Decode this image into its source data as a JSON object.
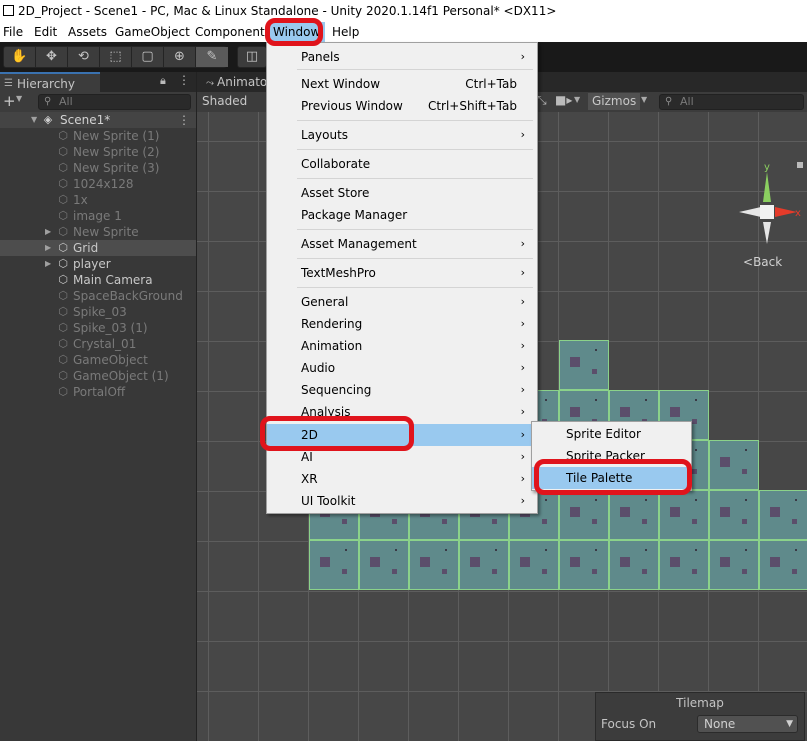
{
  "window": {
    "title": "2D_Project - Scene1 - PC, Mac & Linux Standalone - Unity 2020.1.14f1 Personal* <DX11>"
  },
  "menubar": {
    "items": [
      "File",
      "Edit",
      "Assets",
      "GameObject",
      "Component",
      "Window",
      "Help"
    ]
  },
  "hierarchy": {
    "tab_label": "Hierarchy",
    "add_symbol": "+",
    "search_placeholder": "All",
    "scene_name": "Scene1*",
    "items": [
      {
        "label": "New Sprite (1)",
        "dim": true
      },
      {
        "label": "New Sprite (2)",
        "dim": true
      },
      {
        "label": "New Sprite (3)",
        "dim": true
      },
      {
        "label": "1024x128",
        "dim": true
      },
      {
        "label": "1x",
        "dim": true
      },
      {
        "label": "image 1",
        "dim": true
      },
      {
        "label": "New Sprite",
        "dim": true,
        "expandable": true
      },
      {
        "label": "Grid",
        "dim": false,
        "expandable": true,
        "selected": true
      },
      {
        "label": "player",
        "dim": false,
        "expandable": true
      },
      {
        "label": "Main Camera",
        "dim": false
      },
      {
        "label": "SpaceBackGround",
        "dim": true
      },
      {
        "label": "Spike_03",
        "dim": true
      },
      {
        "label": "Spike_03 (1)",
        "dim": true
      },
      {
        "label": "Crystal_01",
        "dim": true
      },
      {
        "label": "GameObject",
        "dim": true
      },
      {
        "label": "GameObject (1)",
        "dim": true
      },
      {
        "label": "PortalOff",
        "dim": true
      }
    ]
  },
  "scene": {
    "tab_label": "Animato",
    "shading_mode": "Shaded",
    "gizmos_label": "Gizmos",
    "search_placeholder": "All",
    "gizmo_axes": {
      "x": "x",
      "y": "y"
    },
    "back_label": "Back",
    "tilemap_overlay": {
      "title": "Tilemap",
      "focus_label": "Focus On",
      "focus_value": "None"
    }
  },
  "window_menu": {
    "items": [
      {
        "label": "Panels",
        "submenu": true
      },
      {
        "label": "Next Window",
        "shortcut": "Ctrl+Tab"
      },
      {
        "label": "Previous Window",
        "shortcut": "Ctrl+Shift+Tab"
      },
      {
        "label": "Layouts",
        "submenu": true
      },
      {
        "label": "Collaborate"
      },
      {
        "label": "Asset Store"
      },
      {
        "label": "Package Manager"
      },
      {
        "label": "Asset Management",
        "submenu": true
      },
      {
        "label": "TextMeshPro",
        "submenu": true
      },
      {
        "label": "General",
        "submenu": true
      },
      {
        "label": "Rendering",
        "submenu": true
      },
      {
        "label": "Animation",
        "submenu": true
      },
      {
        "label": "Audio",
        "submenu": true
      },
      {
        "label": "Sequencing",
        "submenu": true
      },
      {
        "label": "Analysis",
        "submenu": true
      },
      {
        "label": "2D",
        "submenu": true,
        "highlighted": true
      },
      {
        "label": "AI",
        "submenu": true
      },
      {
        "label": "XR",
        "submenu": true
      },
      {
        "label": "UI Toolkit",
        "submenu": true
      }
    ],
    "submenu_arrow": "›"
  },
  "submenu_2d": {
    "items": [
      {
        "label": "Sprite Editor"
      },
      {
        "label": "Sprite Packer"
      },
      {
        "label": "Tile Palette",
        "highlighted": true
      }
    ]
  },
  "colors": {
    "annotation_red": "#e0141c",
    "menu_highlight": "#99c9ef",
    "tile_fill": "#5f8a8b",
    "tile_border": "#8bd28a"
  }
}
